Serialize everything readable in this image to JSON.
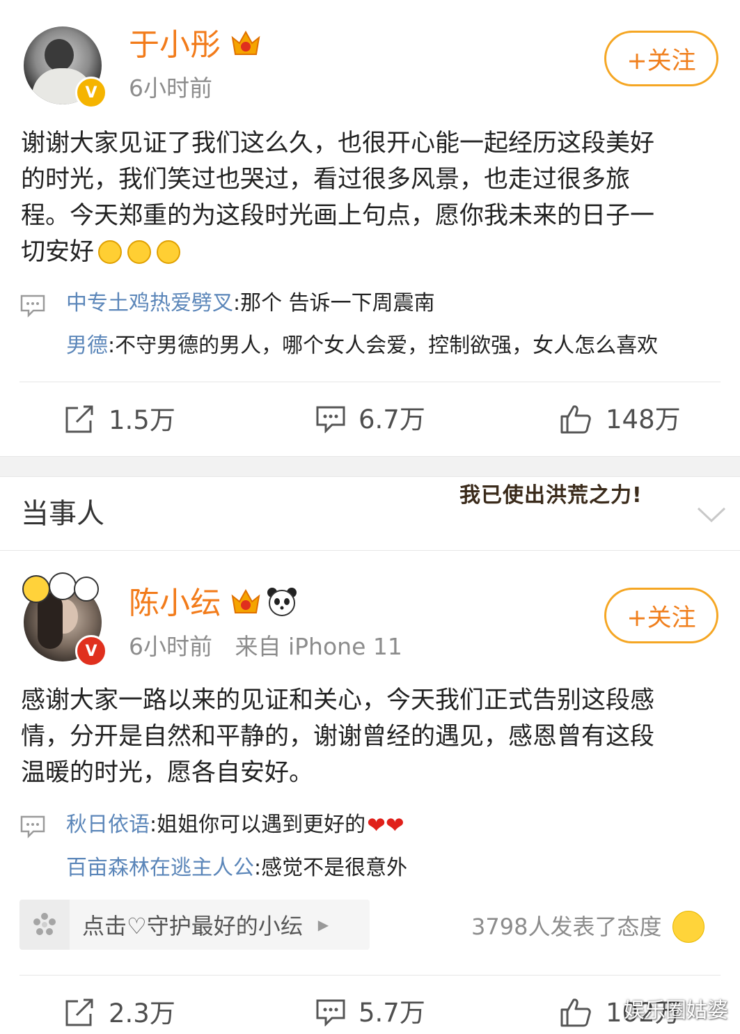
{
  "post1": {
    "username": "于小彤",
    "time": "6小时前",
    "follow_label": "+关注",
    "text_lines": [
      "谢谢大家见证了我们这么久，也很开心能一起经历这段美好",
      "的时光，我们笑过也哭过，看过很多风景，也走过很多旅",
      "程。今天郑重的为这段时光画上句点，愿你我未来的日子一",
      "切安好"
    ],
    "comments": [
      {
        "name": "中专土鸡热爱劈叉",
        "text": ":那个 告诉一下周震南"
      },
      {
        "name": "男德",
        "text": ":不守男德的男人，哪个女人会爱，控制欲强，女人怎么喜欢"
      }
    ],
    "stats": {
      "repost": "1.5万",
      "comment": "6.7万",
      "like": "148万"
    }
  },
  "section": {
    "title": "当事人",
    "sticker_text": "我已使出洪荒之力!"
  },
  "post2": {
    "username": "陈小纭",
    "time": "6小时前",
    "source": "来自 iPhone 11",
    "follow_label": "+关注",
    "text_lines": [
      "感谢大家一路以来的见证和关心，今天我们正式告别这段感",
      "情，分开是自然和平静的，谢谢曾经的遇见，感恩曾有这段",
      "温暖的时光，愿各自安好。"
    ],
    "comments": [
      {
        "name": "秋日依语",
        "text": ":姐姐你可以遇到更好的"
      },
      {
        "name": "百亩森林在逃主人公",
        "text": ":感觉不是很意外"
      }
    ],
    "guard_label": "点击♡守护最好的小纭",
    "reactions": "3798人发表了态度",
    "stats": {
      "repost": "2.3万",
      "comment": "5.7万",
      "like": "102万"
    }
  },
  "watermark": "娱乐圈姑婆",
  "colors": {
    "username": "#f27b1a",
    "commenter": "#5b86b9",
    "follow_border": "#f5a623",
    "verified_gold": "#f5b400",
    "verified_red": "#e0301e"
  }
}
